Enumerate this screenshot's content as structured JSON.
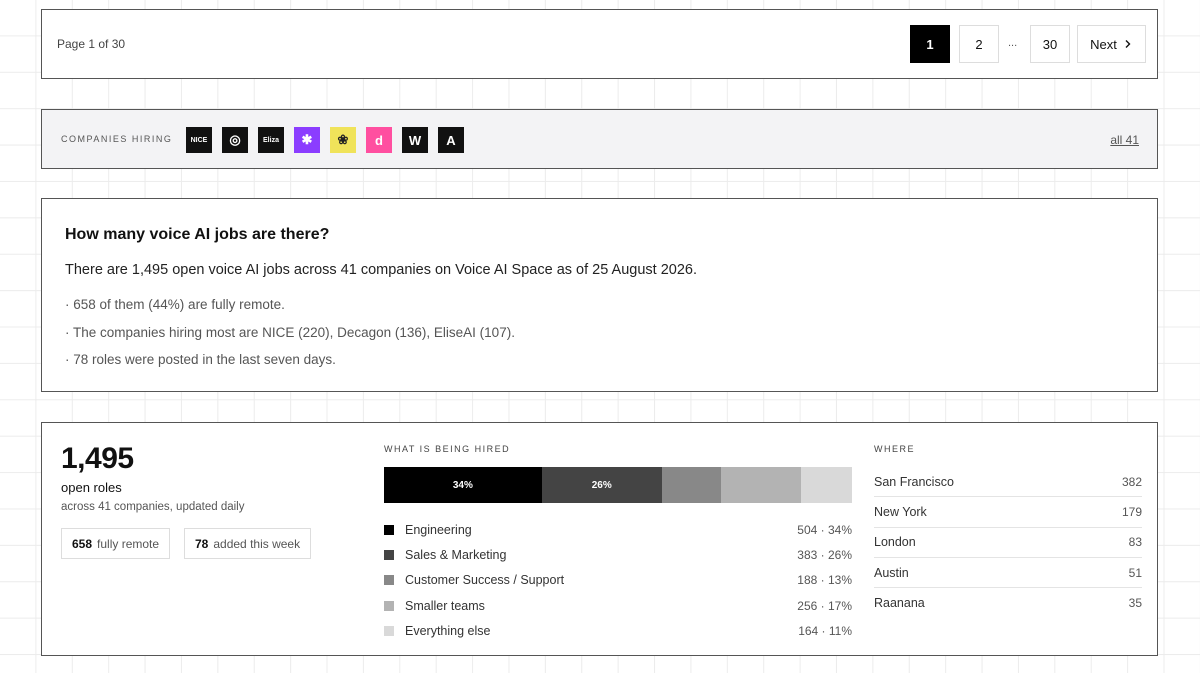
{
  "pagination": {
    "status": "Page 1 of 30",
    "pages": [
      "1",
      "2",
      "30"
    ],
    "ellipsis": "...",
    "next_label": "Next",
    "next_icon": "chevron-right-icon"
  },
  "companies": {
    "label": "COMPANIES HIRING",
    "logos": [
      {
        "name": "nice-logo",
        "text": "NICE",
        "bg": "#111111",
        "fg": "#ffffff"
      },
      {
        "name": "decagon-logo",
        "text": "◎",
        "bg": "#111111",
        "fg": "#ffffff"
      },
      {
        "name": "eliseai-logo",
        "text": "Eliza",
        "bg": "#111111",
        "fg": "#ffffff"
      },
      {
        "name": "starburst-logo",
        "text": "✱",
        "bg": "#8b3dff",
        "fg": "#ffffff"
      },
      {
        "name": "flower-logo",
        "text": "❀",
        "bg": "#f0e35a",
        "fg": "#222222"
      },
      {
        "name": "d-logo",
        "text": "d",
        "bg": "#ff4fa0",
        "fg": "#ffffff"
      },
      {
        "name": "w-logo",
        "text": "W",
        "bg": "#111111",
        "fg": "#ffffff"
      },
      {
        "name": "a-logo",
        "text": "A",
        "bg": "#111111",
        "fg": "#ffffff"
      }
    ],
    "all_link": "all 41"
  },
  "faq": {
    "question": "How many voice AI jobs are there?",
    "answer": "There are 1,495 open voice AI jobs across 41 companies on Voice AI Space as of 25 August 2026.",
    "points": [
      "· 658 of them (44%) are fully remote.",
      "· The companies hiring most are NICE (220), Decagon (136), EliseAI (107).",
      "· 78 roles were posted in the last seven days."
    ]
  },
  "stats": {
    "total": "1,495",
    "total_label": "open roles",
    "subtitle": "across 41 companies, updated daily",
    "remote_count": "658",
    "remote_label": "fully remote",
    "week_count": "78",
    "week_label": "added this week"
  },
  "hiring": {
    "label": "WHAT IS BEING HIRED",
    "categories": [
      {
        "name": "Engineering",
        "count": 504,
        "pct": 34,
        "value": "504 · 34%",
        "color": "#000000",
        "bar_label": "34%"
      },
      {
        "name": "Sales & Marketing",
        "count": 383,
        "pct": 26,
        "value": "383 · 26%",
        "color": "#444444",
        "bar_label": "26%"
      },
      {
        "name": "Customer Success / Support",
        "count": 188,
        "pct": 13,
        "value": "188 · 13%",
        "color": "#888888",
        "bar_label": ""
      },
      {
        "name": "Smaller teams",
        "count": 256,
        "pct": 17,
        "value": "256 · 17%",
        "color": "#b3b3b3",
        "bar_label": ""
      },
      {
        "name": "Everything else",
        "count": 164,
        "pct": 11,
        "value": "164 · 11%",
        "color": "#d9d9d9",
        "bar_label": ""
      }
    ]
  },
  "where": {
    "label": "WHERE",
    "locations": [
      {
        "city": "San Francisco",
        "count": "382"
      },
      {
        "city": "New York",
        "count": "179"
      },
      {
        "city": "London",
        "count": "83"
      },
      {
        "city": "Austin",
        "count": "51"
      },
      {
        "city": "Raanana",
        "count": "35"
      }
    ]
  }
}
